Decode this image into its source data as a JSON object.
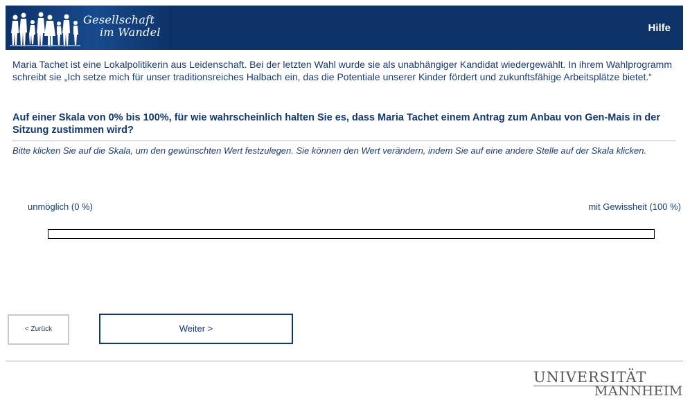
{
  "header": {
    "logo_line1": "Gesellschaft",
    "logo_line2": "im Wandel",
    "help_label": "Hilfe",
    "background_color": "#0d3268"
  },
  "intro_text": "Maria Tachet ist eine Lokalpolitikerin aus Leidenschaft. Bei der letzten Wahl wurde sie als unabhängiger Kandidat wiedergewählt. In ihrem Wahlprogramm schreibt sie „Ich setze mich für unser traditionsreiches Halbach ein, das die Potentiale unserer Kinder fördert und zukunftsfähige Arbeitsplätze bietet.“",
  "question_text": "Auf einer Skala von 0% bis 100%, für wie wahrscheinlich halten Sie es, dass Maria Tachet einem Antrag zum Anbau von Gen-Mais in der Sitzung zustimmen wird?",
  "instruction_text": "Bitte klicken Sie auf die Skala, um den gewünschten Wert festzulegen. Sie können den Wert verändern, indem Sie auf eine andere Stelle auf der Skala klicken.",
  "scale": {
    "min_label": "unmöglich (0 %)",
    "max_label": "mit Gewissheit (100 %)"
  },
  "navigation": {
    "back_label": "< Zurück",
    "next_label": "Weiter >"
  },
  "footer": {
    "logo_line1": "UNIVERSITÄT",
    "logo_line2": "MANNHEIM"
  },
  "colors": {
    "primary": "#0d3268",
    "text": "#163d78"
  }
}
